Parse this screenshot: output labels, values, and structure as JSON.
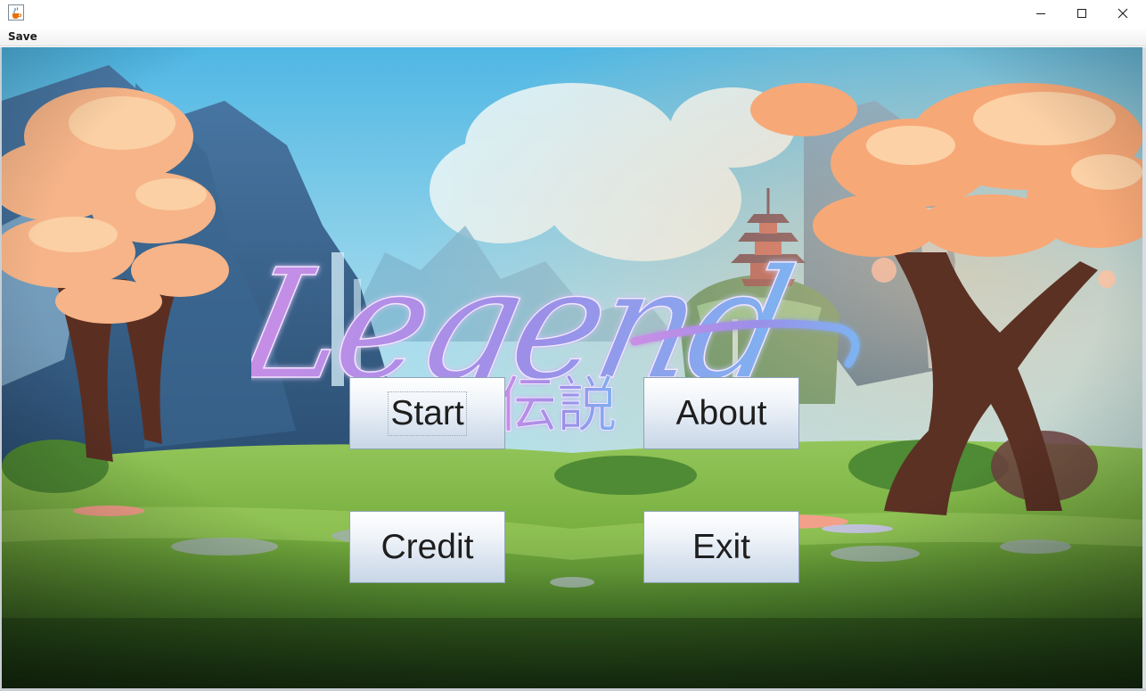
{
  "window": {
    "app_icon": "java-cup-icon",
    "controls": [
      "minimize-icon",
      "maximize-icon",
      "close-icon"
    ]
  },
  "menubar": {
    "items": [
      {
        "label": "Save"
      }
    ]
  },
  "logo": {
    "title": "Legend",
    "subtitle": "伝説",
    "colors": {
      "start": "#c98ee6",
      "mid": "#9b8fe8",
      "end": "#7fb2f0"
    }
  },
  "buttons": {
    "start": "Start",
    "about": "About",
    "credit": "Credit",
    "exit": "Exit"
  },
  "background": {
    "sky": "#7ec9ea",
    "grass": "#6fae3a",
    "blossom": "#f7b38a"
  }
}
